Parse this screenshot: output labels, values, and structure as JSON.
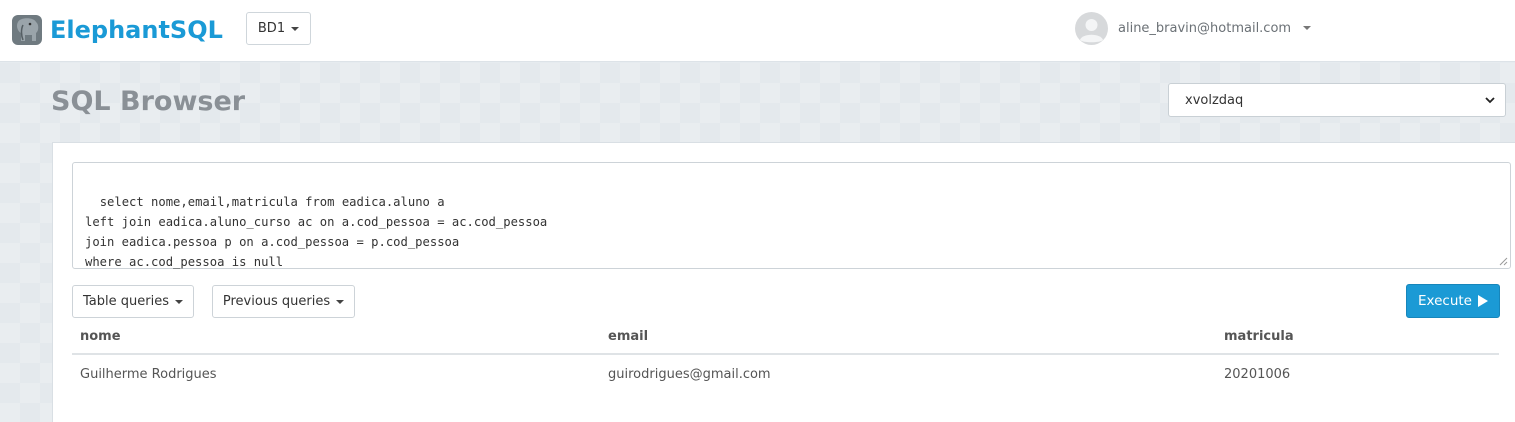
{
  "navbar": {
    "brand": "ElephantSQL",
    "db_selector": "BD1",
    "user_email": "aline_bravin@hotmail.com"
  },
  "page": {
    "title": "SQL Browser",
    "instance": "xvolzdaq"
  },
  "editor": {
    "query": "select nome,email,matricula from eadica.aluno a\nleft join eadica.aluno_curso ac on a.cod_pessoa = ac.cod_pessoa\njoin eadica.pessoa p on a.cod_pessoa = p.cod_pessoa\nwhere ac.cod_pessoa is null"
  },
  "toolbar": {
    "table_queries": "Table queries",
    "previous_queries": "Previous queries",
    "execute": "Execute"
  },
  "results": {
    "columns": [
      "nome",
      "email",
      "matricula"
    ],
    "rows": [
      [
        "Guilherme Rodrigues",
        "guirodrigues@gmail.com",
        "20201006"
      ]
    ]
  },
  "colors": {
    "brand": "#1a9ad6",
    "execute_button": "#1b9ad5",
    "background": "#e6ebef"
  },
  "icons": [
    "elephant-logo-icon",
    "avatar-icon",
    "caret-down-icon",
    "play-icon",
    "select-chevron-icon"
  ]
}
